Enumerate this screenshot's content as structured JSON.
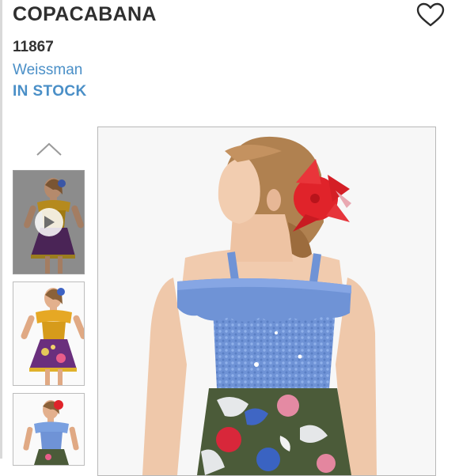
{
  "product": {
    "title": "COPACABANA",
    "sku": "11867",
    "brand": "Weissman",
    "stock_status": "IN STOCK"
  },
  "icons": {
    "wishlist": "heart-outline-icon",
    "thumbs_up": "chevron-up-icon",
    "video": "play-icon"
  },
  "colors": {
    "text_dark": "#2f2f2f",
    "accent_blue": "#4a8fc7",
    "costume_blue": "#6f93d6",
    "flower_red": "#e0232a",
    "skirt_green": "#4b5b39",
    "top_gold": "#d9a228",
    "skirt_purple": "#6a2f7d"
  }
}
